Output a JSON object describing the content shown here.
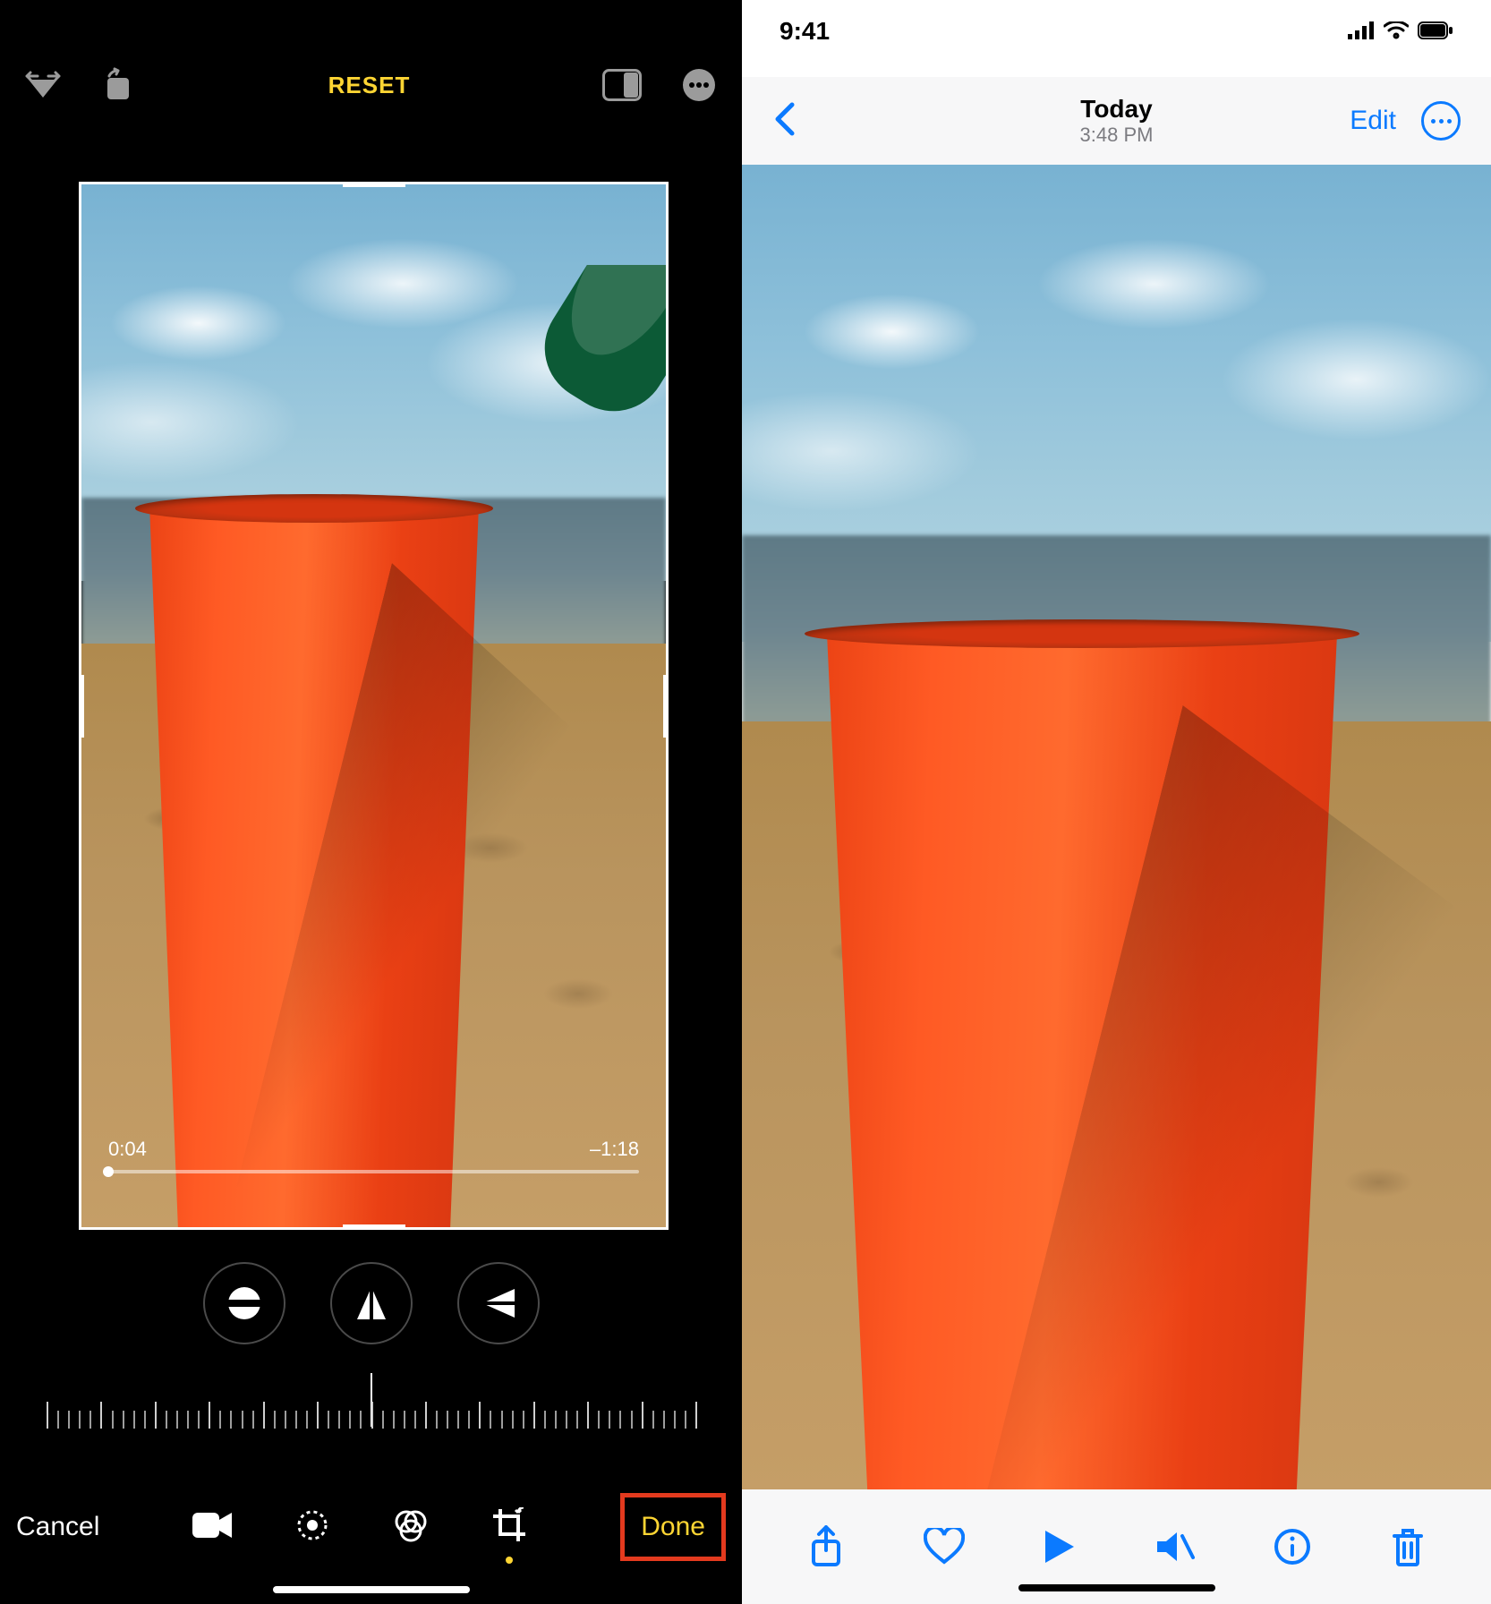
{
  "left_editor": {
    "top": {
      "reset_label": "RESET"
    },
    "playback": {
      "elapsed": "0:04",
      "remaining": "–1:18"
    },
    "bottom": {
      "cancel_label": "Cancel",
      "done_label": "Done",
      "active_tool_index": 3
    }
  },
  "right_viewer": {
    "status": {
      "time": "9:41"
    },
    "nav": {
      "title": "Today",
      "subtitle": "3:48 PM",
      "edit_label": "Edit"
    }
  },
  "colors": {
    "accent_yellow": "#fdd533",
    "ios_blue": "#0b7aff",
    "highlight_red": "#e33a1e"
  }
}
